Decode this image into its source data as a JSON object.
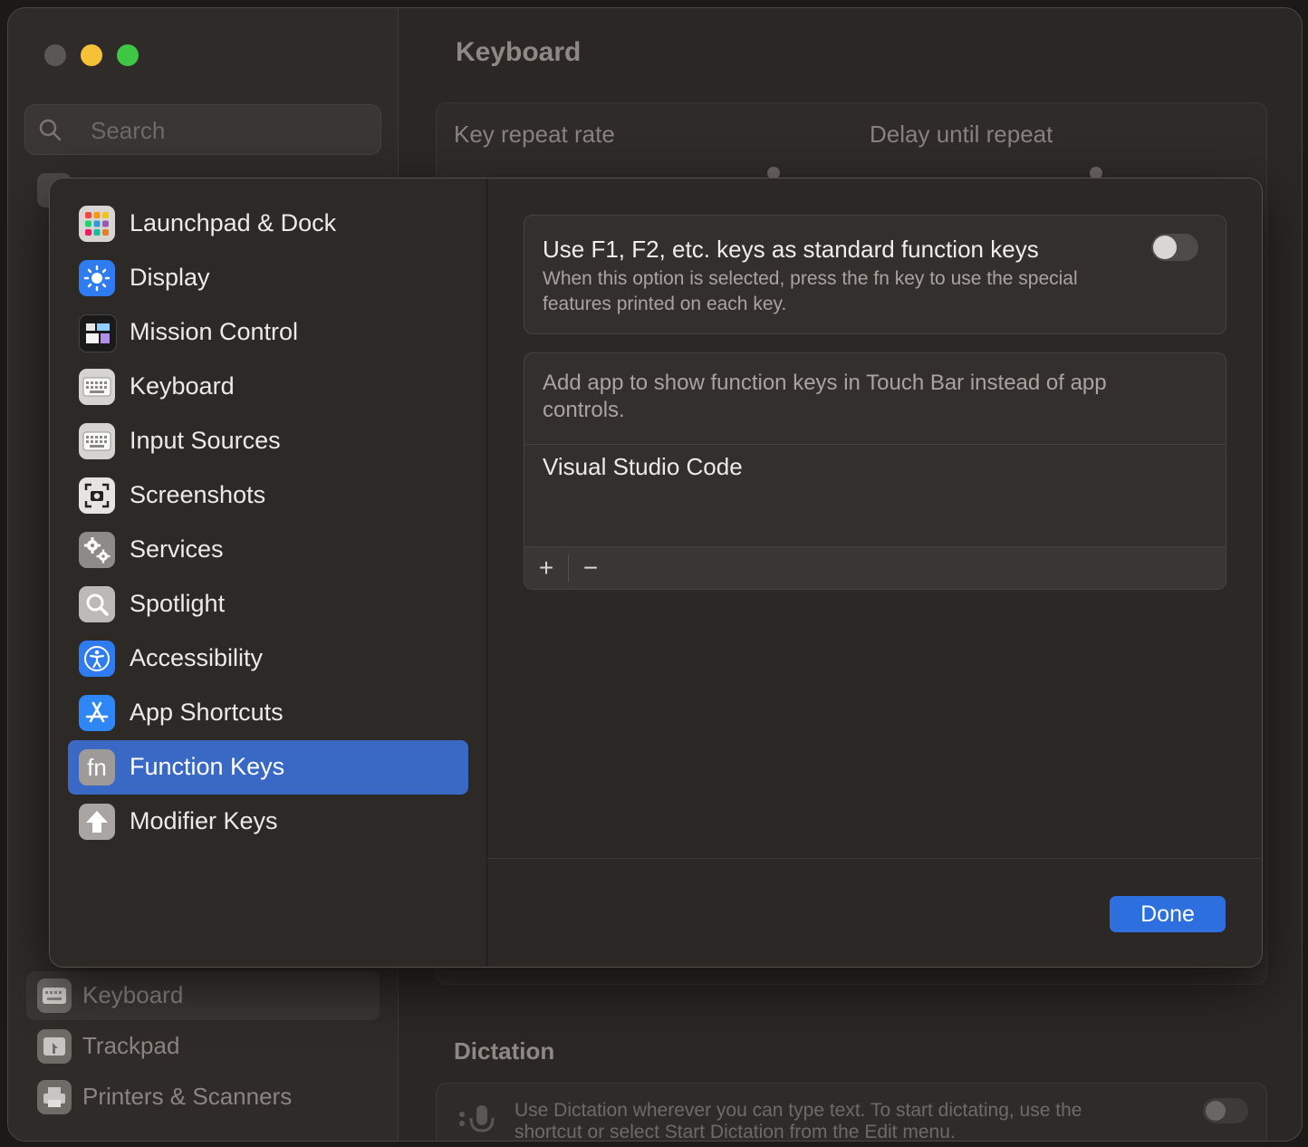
{
  "window": {
    "title": "Keyboard",
    "search_placeholder": "Search",
    "sidebar_bottom_items": [
      {
        "label": "Keyboard",
        "icon": "keyboard-icon"
      },
      {
        "label": "Trackpad",
        "icon": "trackpad-icon"
      },
      {
        "label": "Printers & Scanners",
        "icon": "printer-icon"
      }
    ],
    "key_repeat_label": "Key repeat rate",
    "delay_label": "Delay until repeat",
    "dictation_title": "Dictation",
    "dictation_text": "Use Dictation wherever you can type text. To start dictating, use the shortcut or select Start Dictation from the Edit menu."
  },
  "sheet": {
    "nav": [
      {
        "label": "Launchpad & Dock",
        "icon": "launchpad-icon"
      },
      {
        "label": "Display",
        "icon": "display-icon"
      },
      {
        "label": "Mission Control",
        "icon": "mission-control-icon"
      },
      {
        "label": "Keyboard",
        "icon": "keyboard-icon"
      },
      {
        "label": "Input Sources",
        "icon": "input-sources-icon"
      },
      {
        "label": "Screenshots",
        "icon": "screenshot-icon"
      },
      {
        "label": "Services",
        "icon": "gears-icon"
      },
      {
        "label": "Spotlight",
        "icon": "spotlight-icon"
      },
      {
        "label": "Accessibility",
        "icon": "accessibility-icon"
      },
      {
        "label": "App Shortcuts",
        "icon": "app-store-icon"
      },
      {
        "label": "Function Keys",
        "icon": "fn-icon",
        "selected": true
      },
      {
        "label": "Modifier Keys",
        "icon": "shift-arrow-icon"
      }
    ],
    "fn_option": {
      "title": "Use F1, F2, etc. keys as standard function keys",
      "description": "When this option is selected, press the fn key to use the special features printed on each key.",
      "enabled": false
    },
    "touchbar": {
      "header": "Add app to show function keys in Touch Bar instead of app controls.",
      "apps": [
        "Visual Studio Code"
      ],
      "add_label": "+",
      "remove_label": "−"
    },
    "done_label": "Done",
    "fn_glyph": "fn"
  },
  "colors": {
    "accent": "#3a69c5",
    "done_button": "#2e6fe0",
    "close": "#5b5754",
    "minimize": "#f5c137",
    "maximize": "#3ec645"
  }
}
